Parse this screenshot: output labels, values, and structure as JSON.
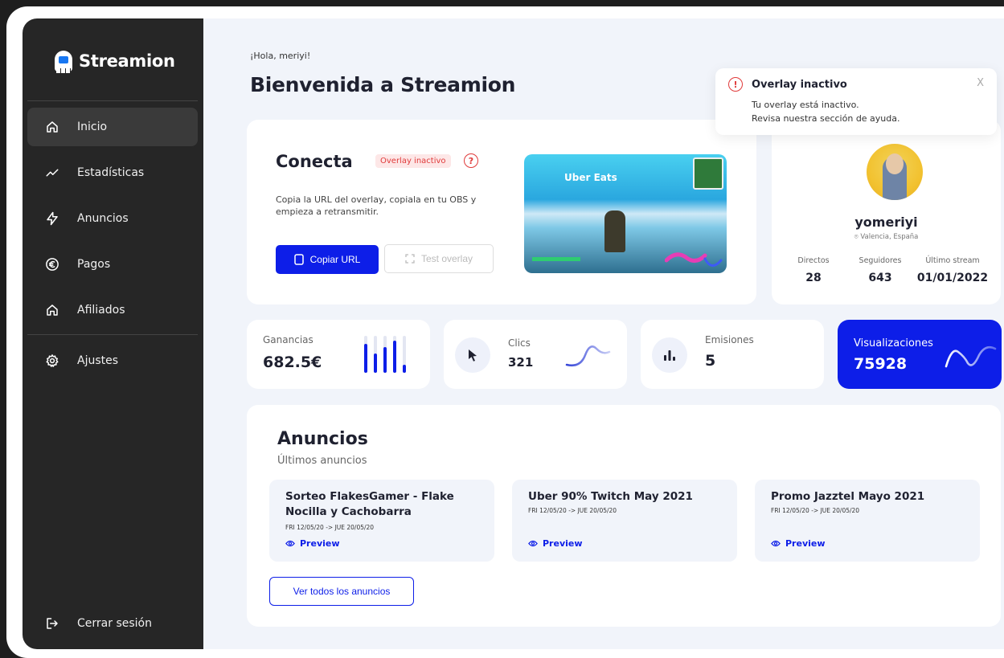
{
  "app": {
    "name": "Streamion"
  },
  "sidebar": {
    "items": [
      {
        "label": "Inicio",
        "icon": "home-icon",
        "active": true
      },
      {
        "label": "Estadísticas",
        "icon": "trend-line-icon"
      },
      {
        "label": "Anuncios",
        "icon": "lightning-icon"
      },
      {
        "label": "Pagos",
        "icon": "euro-icon"
      },
      {
        "label": "Afiliados",
        "icon": "home-icon"
      },
      {
        "label": "Ajustes",
        "icon": "gear-icon"
      }
    ],
    "logout": "Cerrar sesión"
  },
  "header": {
    "greeting": "¡Hola, meriyi!",
    "title": "Bienvenida a Streamion"
  },
  "connect": {
    "title": "Conecta",
    "badge": "Overlay inactivo",
    "help": "?",
    "description": "Copia la URL del overlay, copiala en tu OBS y empieza a retransmitir.",
    "copy_button": "Copiar URL",
    "test_button": "Test overlay",
    "preview_ad_text": "Uber Eats"
  },
  "toast": {
    "icon": "!",
    "title": "Overlay inactivo",
    "close": "X",
    "line1": "Tu overlay está inactivo.",
    "line2": "Revisa nuestra sección de ayuda."
  },
  "profile": {
    "name": "yomeriyi",
    "location": "Valencia, España",
    "stats": [
      {
        "label": "Directos",
        "value": "28"
      },
      {
        "label": "Seguidores",
        "value": "643"
      },
      {
        "label": "Último stream",
        "value": "01/01/2022"
      }
    ]
  },
  "metrics": {
    "earnings": {
      "label": "Ganancias",
      "value": "682.5€"
    },
    "clicks": {
      "label": "Clics",
      "value": "321"
    },
    "emissions": {
      "label": "Emisiones",
      "value": "5"
    },
    "views": {
      "label": "Visualizaciones",
      "value": "75928"
    }
  },
  "ads": {
    "title": "Anuncios",
    "subtitle": "Últimos anuncios",
    "preview_label": "Preview",
    "items": [
      {
        "title": "Sorteo FlakesGamer - Flake Nocilla y Cachobarra",
        "date": "FRI 12/05/20 -> JUE 20/05/20"
      },
      {
        "title": "Uber 90% Twitch May 2021",
        "date": "FRI 12/05/20 -> JUE 20/05/20"
      },
      {
        "title": "Promo Jazztel Mayo 2021",
        "date": "FRI 12/05/20 -> JUE 20/05/20"
      }
    ],
    "view_all": "Ver todos los anuncios"
  },
  "colors": {
    "accent": "#0d1ee8",
    "sidebar": "#262626",
    "background": "#f1f4fa",
    "danger": "#e03a3a"
  }
}
